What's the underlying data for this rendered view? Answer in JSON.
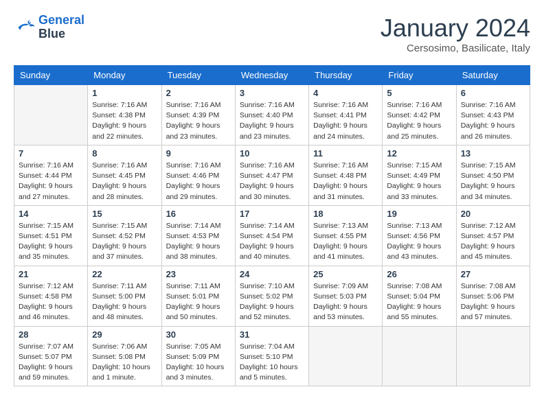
{
  "header": {
    "logo_line1": "General",
    "logo_line2": "Blue",
    "month": "January 2024",
    "location": "Cersosimo, Basilicate, Italy"
  },
  "weekdays": [
    "Sunday",
    "Monday",
    "Tuesday",
    "Wednesday",
    "Thursday",
    "Friday",
    "Saturday"
  ],
  "weeks": [
    [
      {
        "day": "",
        "info": ""
      },
      {
        "day": "1",
        "info": "Sunrise: 7:16 AM\nSunset: 4:38 PM\nDaylight: 9 hours\nand 22 minutes."
      },
      {
        "day": "2",
        "info": "Sunrise: 7:16 AM\nSunset: 4:39 PM\nDaylight: 9 hours\nand 23 minutes."
      },
      {
        "day": "3",
        "info": "Sunrise: 7:16 AM\nSunset: 4:40 PM\nDaylight: 9 hours\nand 23 minutes."
      },
      {
        "day": "4",
        "info": "Sunrise: 7:16 AM\nSunset: 4:41 PM\nDaylight: 9 hours\nand 24 minutes."
      },
      {
        "day": "5",
        "info": "Sunrise: 7:16 AM\nSunset: 4:42 PM\nDaylight: 9 hours\nand 25 minutes."
      },
      {
        "day": "6",
        "info": "Sunrise: 7:16 AM\nSunset: 4:43 PM\nDaylight: 9 hours\nand 26 minutes."
      }
    ],
    [
      {
        "day": "7",
        "info": "Sunrise: 7:16 AM\nSunset: 4:44 PM\nDaylight: 9 hours\nand 27 minutes."
      },
      {
        "day": "8",
        "info": "Sunrise: 7:16 AM\nSunset: 4:45 PM\nDaylight: 9 hours\nand 28 minutes."
      },
      {
        "day": "9",
        "info": "Sunrise: 7:16 AM\nSunset: 4:46 PM\nDaylight: 9 hours\nand 29 minutes."
      },
      {
        "day": "10",
        "info": "Sunrise: 7:16 AM\nSunset: 4:47 PM\nDaylight: 9 hours\nand 30 minutes."
      },
      {
        "day": "11",
        "info": "Sunrise: 7:16 AM\nSunset: 4:48 PM\nDaylight: 9 hours\nand 31 minutes."
      },
      {
        "day": "12",
        "info": "Sunrise: 7:15 AM\nSunset: 4:49 PM\nDaylight: 9 hours\nand 33 minutes."
      },
      {
        "day": "13",
        "info": "Sunrise: 7:15 AM\nSunset: 4:50 PM\nDaylight: 9 hours\nand 34 minutes."
      }
    ],
    [
      {
        "day": "14",
        "info": "Sunrise: 7:15 AM\nSunset: 4:51 PM\nDaylight: 9 hours\nand 35 minutes."
      },
      {
        "day": "15",
        "info": "Sunrise: 7:15 AM\nSunset: 4:52 PM\nDaylight: 9 hours\nand 37 minutes."
      },
      {
        "day": "16",
        "info": "Sunrise: 7:14 AM\nSunset: 4:53 PM\nDaylight: 9 hours\nand 38 minutes."
      },
      {
        "day": "17",
        "info": "Sunrise: 7:14 AM\nSunset: 4:54 PM\nDaylight: 9 hours\nand 40 minutes."
      },
      {
        "day": "18",
        "info": "Sunrise: 7:13 AM\nSunset: 4:55 PM\nDaylight: 9 hours\nand 41 minutes."
      },
      {
        "day": "19",
        "info": "Sunrise: 7:13 AM\nSunset: 4:56 PM\nDaylight: 9 hours\nand 43 minutes."
      },
      {
        "day": "20",
        "info": "Sunrise: 7:12 AM\nSunset: 4:57 PM\nDaylight: 9 hours\nand 45 minutes."
      }
    ],
    [
      {
        "day": "21",
        "info": "Sunrise: 7:12 AM\nSunset: 4:58 PM\nDaylight: 9 hours\nand 46 minutes."
      },
      {
        "day": "22",
        "info": "Sunrise: 7:11 AM\nSunset: 5:00 PM\nDaylight: 9 hours\nand 48 minutes."
      },
      {
        "day": "23",
        "info": "Sunrise: 7:11 AM\nSunset: 5:01 PM\nDaylight: 9 hours\nand 50 minutes."
      },
      {
        "day": "24",
        "info": "Sunrise: 7:10 AM\nSunset: 5:02 PM\nDaylight: 9 hours\nand 52 minutes."
      },
      {
        "day": "25",
        "info": "Sunrise: 7:09 AM\nSunset: 5:03 PM\nDaylight: 9 hours\nand 53 minutes."
      },
      {
        "day": "26",
        "info": "Sunrise: 7:08 AM\nSunset: 5:04 PM\nDaylight: 9 hours\nand 55 minutes."
      },
      {
        "day": "27",
        "info": "Sunrise: 7:08 AM\nSunset: 5:06 PM\nDaylight: 9 hours\nand 57 minutes."
      }
    ],
    [
      {
        "day": "28",
        "info": "Sunrise: 7:07 AM\nSunset: 5:07 PM\nDaylight: 9 hours\nand 59 minutes."
      },
      {
        "day": "29",
        "info": "Sunrise: 7:06 AM\nSunset: 5:08 PM\nDaylight: 10 hours\nand 1 minute."
      },
      {
        "day": "30",
        "info": "Sunrise: 7:05 AM\nSunset: 5:09 PM\nDaylight: 10 hours\nand 3 minutes."
      },
      {
        "day": "31",
        "info": "Sunrise: 7:04 AM\nSunset: 5:10 PM\nDaylight: 10 hours\nand 5 minutes."
      },
      {
        "day": "",
        "info": ""
      },
      {
        "day": "",
        "info": ""
      },
      {
        "day": "",
        "info": ""
      }
    ]
  ]
}
